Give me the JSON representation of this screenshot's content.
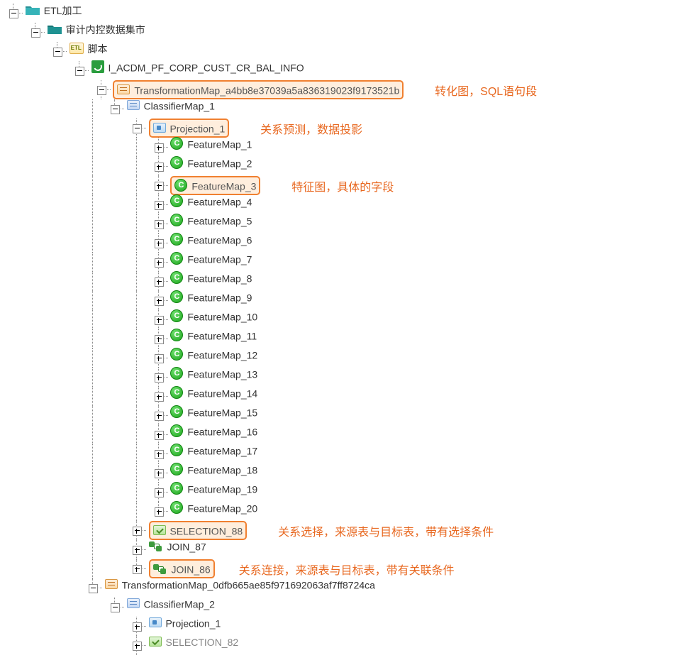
{
  "tree": {
    "root": "ETL加工",
    "level1": "审计内控数据集市",
    "level2": "脚本",
    "level3": "I_ACDM_PF_CORP_CUST_CR_BAL_INFO",
    "transformationMap1": "TransformationMap_a4bb8e37039a5a836319023f9173521b",
    "classifierMap1": "ClassifierMap_1",
    "projection1": "Projection_1",
    "featureMaps": [
      "FeatureMap_1",
      "FeatureMap_2",
      "FeatureMap_3",
      "FeatureMap_4",
      "FeatureMap_5",
      "FeatureMap_6",
      "FeatureMap_7",
      "FeatureMap_8",
      "FeatureMap_9",
      "FeatureMap_10",
      "FeatureMap_11",
      "FeatureMap_12",
      "FeatureMap_13",
      "FeatureMap_14",
      "FeatureMap_15",
      "FeatureMap_16",
      "FeatureMap_17",
      "FeatureMap_18",
      "FeatureMap_19",
      "FeatureMap_20"
    ],
    "selection88": "SELECTION_88",
    "join87": "JOIN_87",
    "join86": "JOIN_86",
    "transformationMap2": "TransformationMap_0dfb665ae85f971692063af7ff8724ca",
    "classifierMap2": "ClassifierMap_2",
    "projection1b": "Projection_1",
    "selection82": "SELECTION_82"
  },
  "annotations": {
    "transformationMap": "转化图，SQL语句段",
    "projection": "关系预测，数据投影",
    "featureMap": "特征图，具体的字段",
    "selection": "关系选择，来源表与目标表，带有选择条件",
    "join": "关系连接，来源表与目标表，带有关联条件"
  },
  "colors": {
    "folder1": "#2fa0a5",
    "folder2": "#1f8e8e",
    "highlightBorder": "#f08030",
    "annotation": "#e86820"
  }
}
